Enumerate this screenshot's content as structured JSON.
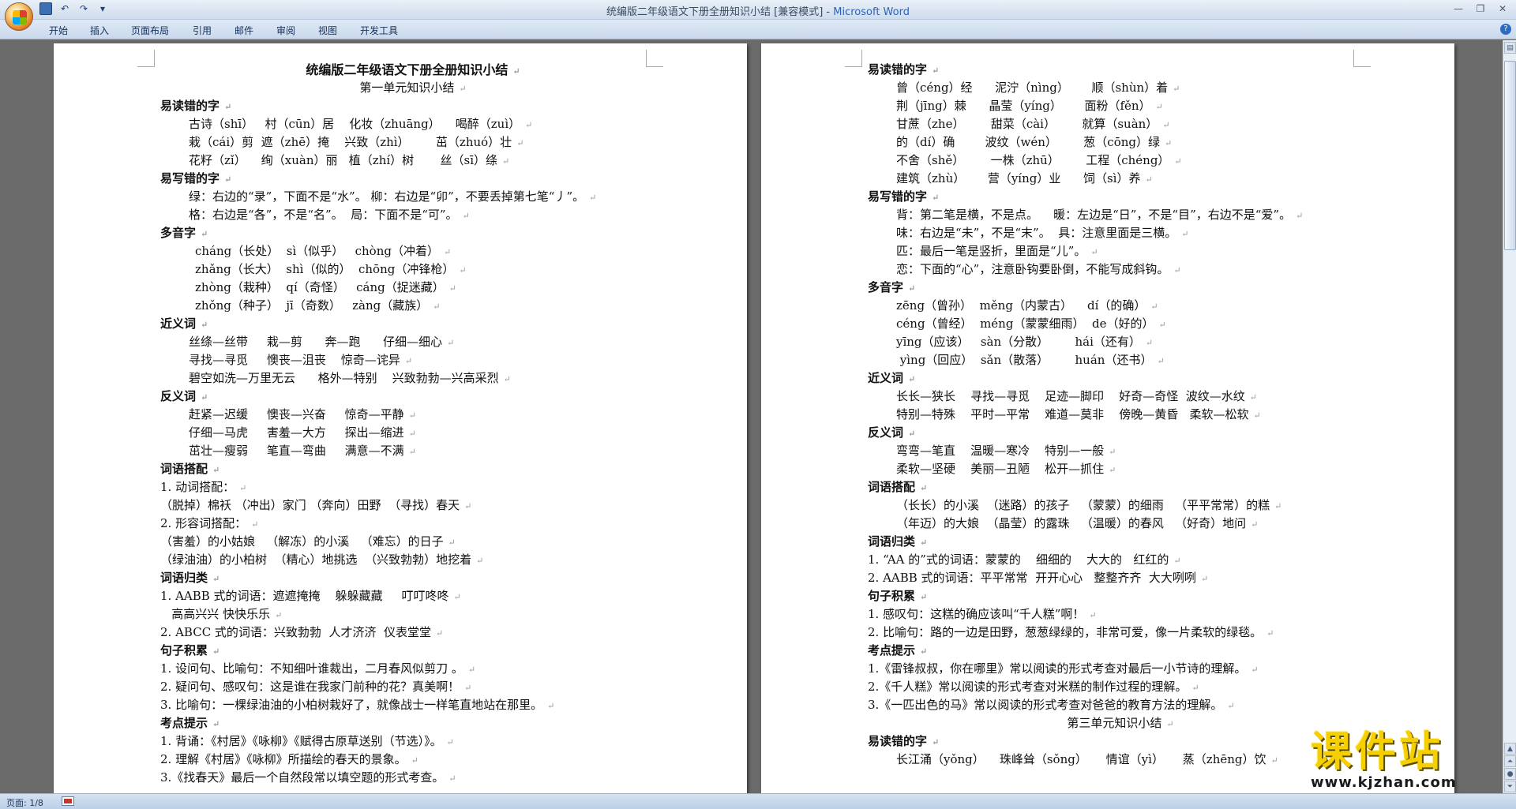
{
  "window": {
    "title_doc": "统编版二年级语文下册全册知识小结 [兼容模式] - ",
    "title_app": "Microsoft Word"
  },
  "ribbon": {
    "tabs": [
      "开始",
      "插入",
      "页面布局",
      "引用",
      "邮件",
      "审阅",
      "视图",
      "开发工具"
    ]
  },
  "status": {
    "page": "页面: 1/8"
  },
  "watermark": {
    "main": "课件站",
    "url": "www.kjzhan.com"
  },
  "page1": {
    "lines": [
      {
        "t": "统编版二年级语文下册全册知识小结",
        "c": "h-title"
      },
      {
        "t": "第一单元知识小结",
        "c": "h-sub"
      },
      {
        "t": "易读错的字",
        "c": "h"
      },
      {
        "t": "古诗（shī）   村（cūn）居    化妆（zhuāng）    喝醉（zuì）",
        "c": "ind1"
      },
      {
        "t": "栽（cái）剪  遮（zhē）掩    兴致（zhì）       茁（zhuó）壮",
        "c": "ind1"
      },
      {
        "t": "花籽（zǐ）    绚（xuàn）丽   植（zhí）树       丝（sī）绦",
        "c": "ind1"
      },
      {
        "t": "易写错的字",
        "c": "h"
      },
      {
        "t": "绿：右边的“录”，下面不是“水”。 柳：右边是“卯”，不要丢掉第七笔“丿”。",
        "c": "ind1"
      },
      {
        "t": "格：右边是“各”，不是“名”。  局：下面不是“可”。",
        "c": "ind1"
      },
      {
        "t": "多音字",
        "c": "h"
      },
      {
        "t": "cháng（长处）  sì（似乎）   chòng（冲着）",
        "c": "ind2"
      },
      {
        "t": "zhǎng（长大）  shì（似的）  chōng（冲锋枪）",
        "c": "ind2"
      },
      {
        "t": "zhòng（栽种）  qí（奇怪）   cáng（捉迷藏）",
        "c": "ind2"
      },
      {
        "t": "zhǒng（种子）  jī（奇数）   zàng（藏族）",
        "c": "ind2"
      },
      {
        "t": "近义词",
        "c": "h"
      },
      {
        "t": "丝绦—丝带     栽—剪      奔—跑      仔细—细心",
        "c": "ind1"
      },
      {
        "t": "寻找—寻觅     懊丧—沮丧    惊奇—诧异",
        "c": "ind1"
      },
      {
        "t": "碧空如洗—万里无云      格外—特别    兴致勃勃—兴高采烈",
        "c": "ind1"
      },
      {
        "t": "反义词",
        "c": "h"
      },
      {
        "t": "赶紧—迟缓     懊丧—兴奋     惊奇—平静",
        "c": "ind1"
      },
      {
        "t": "仔细—马虎     害羞—大方     探出—缩进",
        "c": "ind1"
      },
      {
        "t": "茁壮—瘦弱     笔直—弯曲     满意—不满",
        "c": "ind1"
      },
      {
        "t": "词语搭配",
        "c": "h"
      },
      {
        "t": "1. 动词搭配：",
        "c": ""
      },
      {
        "t": "（脱掉）棉袄 （冲出）家门 （奔向）田野  （寻找）春天",
        "c": ""
      },
      {
        "t": "2. 形容词搭配：",
        "c": ""
      },
      {
        "t": "（害羞）的小姑娘   （解冻）的小溪   （难忘）的日子",
        "c": ""
      },
      {
        "t": "（绿油油）的小柏树  （精心）地挑选  （兴致勃勃）地挖着",
        "c": ""
      },
      {
        "t": "词语归类",
        "c": "h"
      },
      {
        "t": "1. AABB 式的词语：遮遮掩掩    躲躲藏藏     叮叮咚咚",
        "c": ""
      },
      {
        "t": "   高高兴兴 快快乐乐",
        "c": ""
      },
      {
        "t": "2. ABCC 式的词语：兴致勃勃  人才济济  仪表堂堂",
        "c": ""
      },
      {
        "t": "句子积累",
        "c": "h"
      },
      {
        "t": "1. 设问句、比喻句：不知细叶谁裁出，二月春风似剪刀 。",
        "c": ""
      },
      {
        "t": "2. 疑问句、感叹句：这是谁在我家门前种的花？真美啊！",
        "c": ""
      },
      {
        "t": "3. 比喻句：一棵绿油油的小柏树栽好了，就像战士一样笔直地站在那里。",
        "c": ""
      },
      {
        "t": "考点提示",
        "c": "h"
      },
      {
        "t": "1. 背诵：《村居》《咏柳》《赋得古原草送别（节选）》。",
        "c": ""
      },
      {
        "t": "2. 理解《村居》《咏柳》所描绘的春天的景象。",
        "c": ""
      },
      {
        "t": "3.《找春天》最后一个自然段常以填空题的形式考查。",
        "c": ""
      }
    ]
  },
  "page2": {
    "lines": [
      {
        "t": "易读错的字",
        "c": "h"
      },
      {
        "t": "曾（céng）经      泥泞（nìng）      顺（shùn）着",
        "c": "ind1"
      },
      {
        "t": "荆（jīng）棘      晶莹（yíng）      面粉（fěn）",
        "c": "ind1"
      },
      {
        "t": "甘蔗（zhe）       甜菜（cài）       就算（suàn）",
        "c": "ind1"
      },
      {
        "t": "的（dí）确        波纹（wén）       葱（cōng）绿",
        "c": "ind1"
      },
      {
        "t": "不舍（shě）       一株（zhū）       工程（chéng）",
        "c": "ind1"
      },
      {
        "t": "建筑（zhù）      营（yíng）业      饲（sì）养",
        "c": "ind1"
      },
      {
        "t": "易写错的字",
        "c": "h"
      },
      {
        "t": "背：第二笔是横，不是点。    暖：左边是“日”，不是“目”，右边不是“爱”。",
        "c": "ind1"
      },
      {
        "t": "味：右边是“未”，不是“末”。  具：注意里面是三横。",
        "c": "ind1"
      },
      {
        "t": "匹：最后一笔是竖折，里面是“儿”。",
        "c": "ind1"
      },
      {
        "t": "恋：下面的“心”，注意卧钩要卧倒，不能写成斜钩。",
        "c": "ind1"
      },
      {
        "t": "多音字",
        "c": "h"
      },
      {
        "t": "zēng（曾孙）  měng（内蒙古）    dí（的确）",
        "c": "ind1"
      },
      {
        "t": "céng（曾经）  méng（蒙蒙细雨）  de（好的）",
        "c": "ind1"
      },
      {
        "t": "yīng（应该）   sàn（分散）       hái（还有）",
        "c": "ind1"
      },
      {
        "t": " yìng（回应）  sǎn（散落）       huán（还书）",
        "c": "ind1"
      },
      {
        "t": "近义词",
        "c": "h"
      },
      {
        "t": "长长—狭长    寻找—寻觅    足迹—脚印    好奇—奇怪  波纹—水纹",
        "c": "ind1"
      },
      {
        "t": "特别—特殊    平时—平常    难道—莫非    傍晚—黄昏   柔软—松软",
        "c": "ind1"
      },
      {
        "t": "反义词",
        "c": "h"
      },
      {
        "t": "弯弯—笔直    温暖—寒冷    特别—一般",
        "c": "ind1"
      },
      {
        "t": "柔软—坚硬    美丽—丑陋    松开—抓住",
        "c": "ind1"
      },
      {
        "t": "词语搭配",
        "c": "h"
      },
      {
        "t": "（长长）的小溪  （迷路）的孩子   （蒙蒙）的细雨   （平平常常）的糕",
        "c": "ind1"
      },
      {
        "t": "（年迈）的大娘  （晶莹）的露珠   （温暖）的春风   （好奇）地问",
        "c": "ind1"
      },
      {
        "t": "词语归类",
        "c": "h"
      },
      {
        "t": "1. “AA 的”式的词语：蒙蒙的    细细的    大大的   红红的",
        "c": ""
      },
      {
        "t": "2. AABB 式的词语：平平常常  开开心心   整整齐齐  大大咧咧",
        "c": ""
      },
      {
        "t": "句子积累",
        "c": "h"
      },
      {
        "t": "1. 感叹句：这糕的确应该叫“千人糕”啊！",
        "c": ""
      },
      {
        "t": "2. 比喻句：路的一边是田野，葱葱绿绿的，非常可爱，像一片柔软的绿毯。",
        "c": ""
      },
      {
        "t": "考点提示",
        "c": "h"
      },
      {
        "t": "1.《雷锋叔叔，你在哪里》常以阅读的形式考查对最后一小节诗的理解。",
        "c": ""
      },
      {
        "t": "2.《千人糕》常以阅读的形式考查对米糕的制作过程的理解。",
        "c": ""
      },
      {
        "t": "3.《一匹出色的马》常以阅读的形式考查对爸爸的教育方法的理解。",
        "c": ""
      },
      {
        "t": "第三单元知识小结",
        "c": "h-sub"
      },
      {
        "t": "易读错的字",
        "c": "h"
      },
      {
        "t": "长江涌（yǒng）    珠峰耸（sǒng）     情谊（yì）     蒸（zhēng）饮",
        "c": "ind1"
      }
    ]
  }
}
